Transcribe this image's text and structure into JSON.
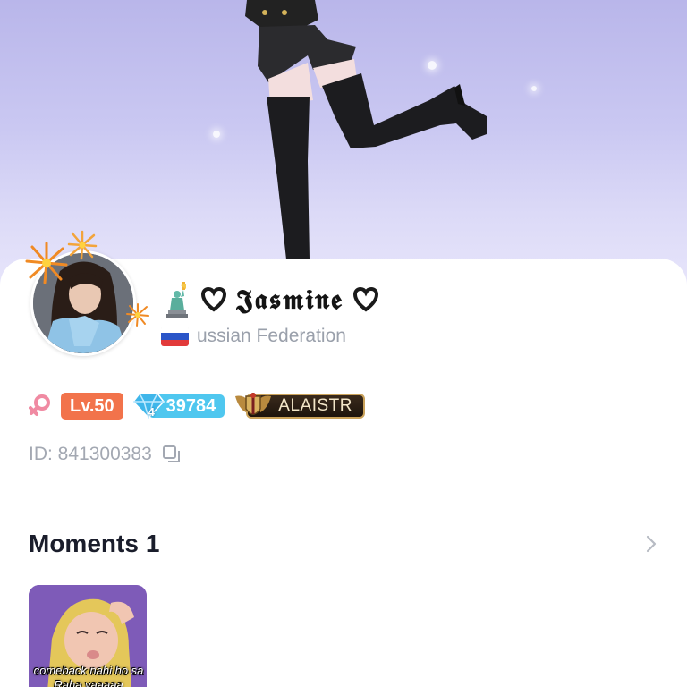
{
  "profile": {
    "display_name": "𝕵𝖆𝖘𝖒𝖎𝖓𝖊",
    "country": "ussian Federation",
    "id_text": "ID: 841300383"
  },
  "badges": {
    "level": "Lv.50",
    "diamond_tier": "4",
    "diamonds": "39784",
    "family": "ALAISTR"
  },
  "moments": {
    "title": "Moments",
    "count": "1",
    "items": [
      {
        "caption": "comeback nahi ho sa Raha yaaaaa"
      }
    ]
  },
  "icons": {
    "name_prefix": "statue-of-liberty-icon",
    "name_decor": "heart-icon",
    "flag": "russia-flag-icon",
    "gender": "female-icon",
    "diamond": "diamond-icon",
    "family": "winged-shield-icon",
    "copy": "copy-icon",
    "more": "chevron-right-icon"
  },
  "colors": {
    "level_badge": "#f2734b",
    "diamond_badge": "#4fc7ef",
    "gender_icon": "#f08aa2",
    "family_border": "#caa25a",
    "muted_text": "#a3a8b2"
  }
}
